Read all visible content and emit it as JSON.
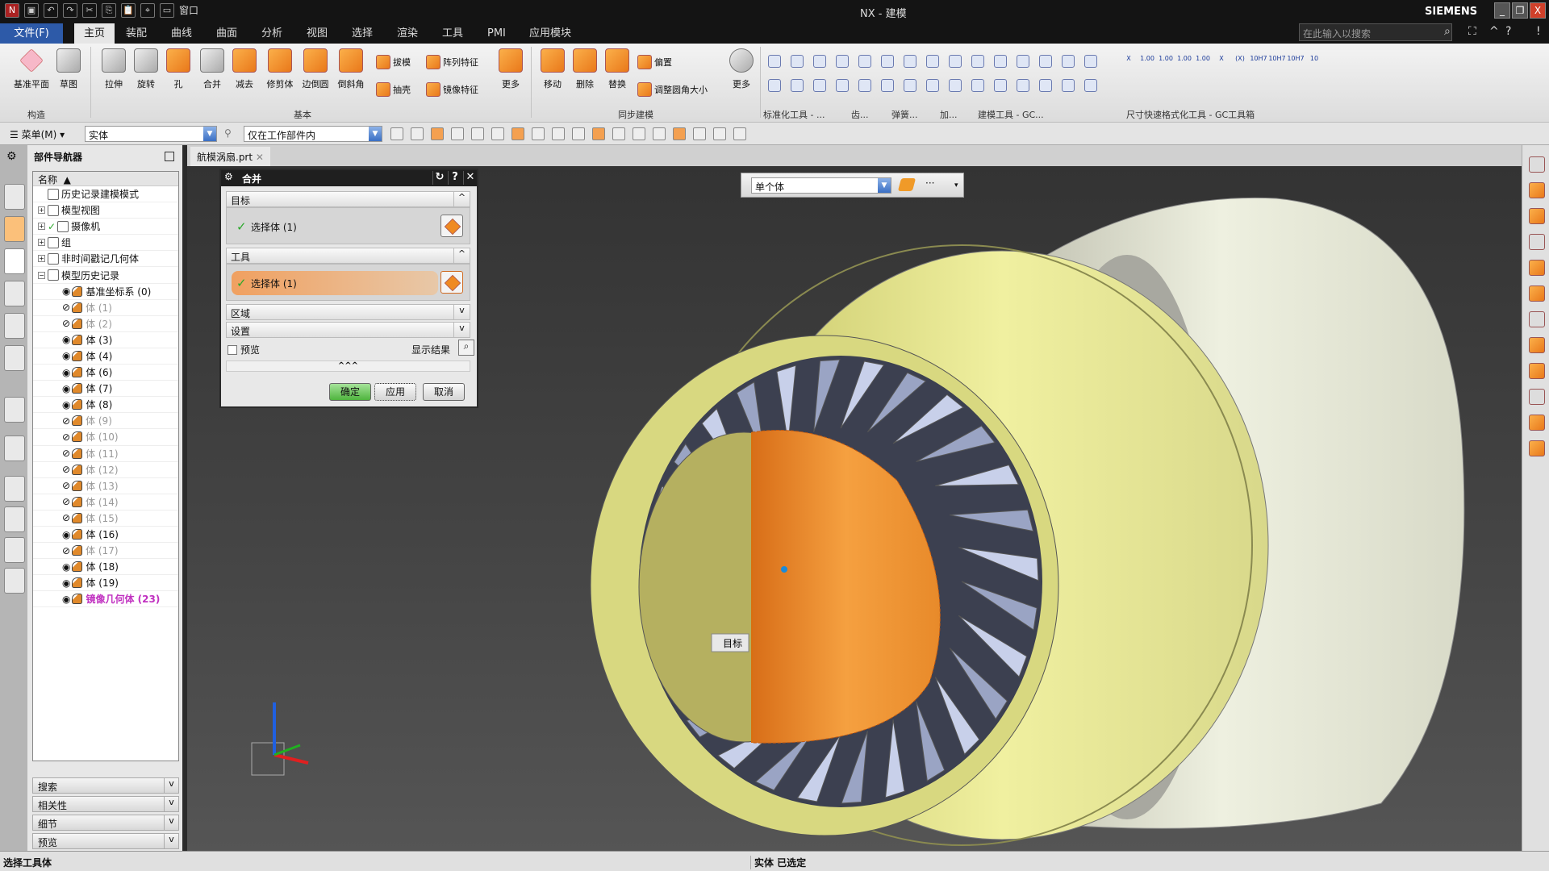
{
  "app": {
    "title": "NX - 建模",
    "brand": "SIEMENS",
    "window_menu": "窗口"
  },
  "tabs": [
    {
      "label": "文件(F)"
    },
    {
      "label": "主页"
    },
    {
      "label": "装配"
    },
    {
      "label": "曲线"
    },
    {
      "label": "曲面"
    },
    {
      "label": "分析"
    },
    {
      "label": "视图"
    },
    {
      "label": "选择"
    },
    {
      "label": "渲染"
    },
    {
      "label": "工具"
    },
    {
      "label": "PMI"
    },
    {
      "label": "应用模块"
    }
  ],
  "search": {
    "placeholder": "在此输入以搜索"
  },
  "ribbon": {
    "large": [
      {
        "label": "基准平面"
      },
      {
        "label": "草图"
      },
      {
        "label": "拉伸"
      },
      {
        "label": "旋转"
      },
      {
        "label": "孔"
      },
      {
        "label": "合并"
      },
      {
        "label": "减去"
      },
      {
        "label": "修剪体"
      },
      {
        "label": "边倒圆"
      },
      {
        "label": "倒斜角"
      },
      {
        "label": "更多"
      },
      {
        "label": "移动"
      },
      {
        "label": "删除"
      },
      {
        "label": "替换"
      },
      {
        "label": "更多"
      }
    ],
    "small": [
      {
        "label": "拔模"
      },
      {
        "label": "阵列特征"
      },
      {
        "label": "抽壳"
      },
      {
        "label": "镜像特征"
      },
      {
        "label": "偏置"
      },
      {
        "label": "调整圆角大小"
      }
    ],
    "groups": [
      {
        "label": "构造"
      },
      {
        "label": "基本"
      },
      {
        "label": "同步建模"
      },
      {
        "label": "标准化工具 - ..."
      },
      {
        "label": "齿..."
      },
      {
        "label": "弹簧..."
      },
      {
        "label": "加..."
      },
      {
        "label": "建模工具 - GC..."
      },
      {
        "label": "尺寸快速格式化工具 - GC工具箱"
      }
    ],
    "dim_tools": [
      "X",
      "1.00",
      "1.00",
      "1.00",
      "1.00",
      "X",
      "(X)",
      "10H7",
      "10H7",
      "10H7",
      "10"
    ]
  },
  "selbar": {
    "menu": "菜单(M)",
    "filter": "实体",
    "scope": "仅在工作部件内"
  },
  "navigator": {
    "title": "部件导航器",
    "column": "名称",
    "items": [
      {
        "label": "历史记录建模模式",
        "level": 0
      },
      {
        "label": "模型视图",
        "level": 0,
        "expand": "+"
      },
      {
        "label": "摄像机",
        "level": 0,
        "expand": "+",
        "checked": true
      },
      {
        "label": "组",
        "level": 0,
        "expand": "+"
      },
      {
        "label": "非时间戳记几何体",
        "level": 0,
        "expand": "+"
      },
      {
        "label": "模型历史记录",
        "level": 0,
        "expand": "−"
      },
      {
        "label": "基准坐标系 (0)",
        "level": 1,
        "visible": true
      },
      {
        "label": "体 (1)",
        "level": 1,
        "visible": false
      },
      {
        "label": "体 (2)",
        "level": 1,
        "visible": false
      },
      {
        "label": "体 (3)",
        "level": 1,
        "visible": true
      },
      {
        "label": "体 (4)",
        "level": 1,
        "visible": true
      },
      {
        "label": "体 (6)",
        "level": 1,
        "visible": true
      },
      {
        "label": "体 (7)",
        "level": 1,
        "visible": true
      },
      {
        "label": "体 (8)",
        "level": 1,
        "visible": true
      },
      {
        "label": "体 (9)",
        "level": 1,
        "visible": false
      },
      {
        "label": "体 (10)",
        "level": 1,
        "visible": false
      },
      {
        "label": "体 (11)",
        "level": 1,
        "visible": false
      },
      {
        "label": "体 (12)",
        "level": 1,
        "visible": false
      },
      {
        "label": "体 (13)",
        "level": 1,
        "visible": false
      },
      {
        "label": "体 (14)",
        "level": 1,
        "visible": false
      },
      {
        "label": "体 (15)",
        "level": 1,
        "visible": false
      },
      {
        "label": "体 (16)",
        "level": 1,
        "visible": true
      },
      {
        "label": "体 (17)",
        "level": 1,
        "visible": false
      },
      {
        "label": "体 (18)",
        "level": 1,
        "visible": true
      },
      {
        "label": "体 (19)",
        "level": 1,
        "visible": true
      },
      {
        "label": "镜像几何体 (23)",
        "level": 1,
        "visible": true,
        "mirror": true
      }
    ],
    "panels": [
      {
        "label": "搜索"
      },
      {
        "label": "相关性"
      },
      {
        "label": "细节"
      },
      {
        "label": "预览"
      }
    ]
  },
  "file_tab": {
    "label": "航模涡扇.prt"
  },
  "dialog": {
    "title": "合并",
    "target": {
      "label": "目标",
      "select": "选择体 (1)"
    },
    "tool": {
      "label": "工具",
      "select": "选择体 (1)"
    },
    "region": "区域",
    "settings": "设置",
    "preview": "预览",
    "preview_checked": false,
    "show_result": "显示结果",
    "more": "^^^",
    "ok": "确定",
    "apply": "应用",
    "cancel": "取消"
  },
  "float_selbar": {
    "value": "单个体",
    "more": "···"
  },
  "viewport": {
    "target_label": "目标"
  },
  "status": {
    "prompt": "选择工具体",
    "info": "实体 已选定"
  },
  "colors": {
    "accent": "#2d5aa8",
    "body_yellow": "#e3e38a",
    "target_orange": "#f0902a",
    "mirror_text": "#c030c0"
  }
}
